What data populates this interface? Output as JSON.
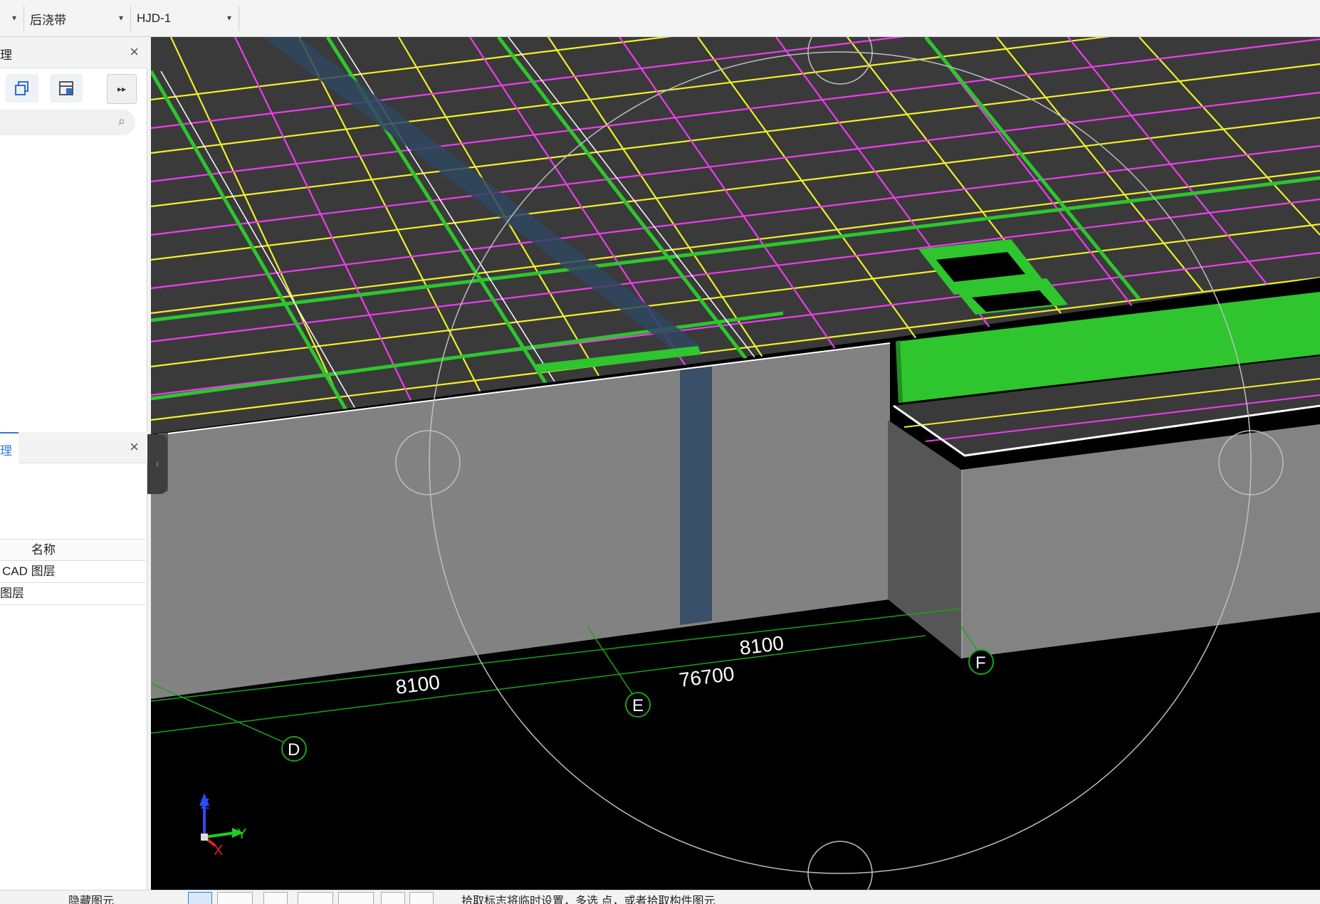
{
  "toolbar": {
    "combo_prev_arrow": "▾",
    "component_type": "后浇带",
    "component_name": "HJD-1"
  },
  "panel_top": {
    "title": "理"
  },
  "panel_layers": {
    "title": "理",
    "column_header": "名称",
    "rows": [
      "CAD 图层",
      "图层"
    ]
  },
  "viewport": {
    "dimensions": {
      "dim_left": "8100",
      "dim_right": "8100",
      "dim_total": "76700"
    },
    "axes": {
      "D": "D",
      "E": "E",
      "F": "F"
    },
    "triad": {
      "x": "X",
      "y": "Y",
      "z": "Z"
    },
    "colors": {
      "grid_yellow": "#f2ef2a",
      "grid_magenta": "#f03cf0",
      "beam_green": "#2ec52e",
      "slab_gray": "#3a3a3a",
      "wall_gray": "#808080",
      "band_blue": "#3a5068"
    }
  },
  "status": {
    "left_text": "隐藏图元",
    "hint_text": "拾取标志将临时设置，多选 点，或者拾取构件图元"
  }
}
